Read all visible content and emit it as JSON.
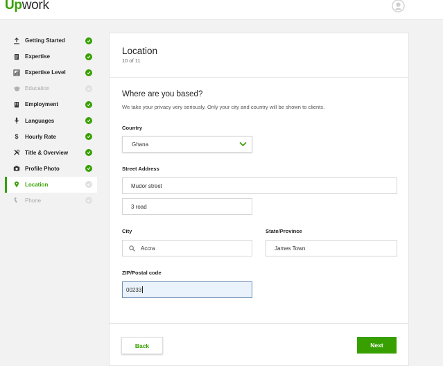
{
  "brand": {
    "logo_up": "Up",
    "logo_rest": "work",
    "accent": "#37a000"
  },
  "sidebar": {
    "items": [
      {
        "label": "Getting Started",
        "icon": "upload-icon",
        "status": "complete"
      },
      {
        "label": "Expertise",
        "icon": "document-icon",
        "status": "complete"
      },
      {
        "label": "Expertise Level",
        "icon": "bar-chart-icon",
        "status": "complete"
      },
      {
        "label": "Education",
        "icon": "graduation-cap-icon",
        "status": "disabled"
      },
      {
        "label": "Employment",
        "icon": "building-icon",
        "status": "complete"
      },
      {
        "label": "Languages",
        "icon": "microphone-icon",
        "status": "complete"
      },
      {
        "label": "Hourly Rate",
        "icon": "dollar-icon",
        "status": "complete"
      },
      {
        "label": "Title & Overview",
        "icon": "tools-icon",
        "status": "complete"
      },
      {
        "label": "Profile Photo",
        "icon": "camera-icon",
        "status": "complete"
      },
      {
        "label": "Location",
        "icon": "map-pin-icon",
        "status": "active"
      },
      {
        "label": "Phone",
        "icon": "phone-icon",
        "status": "disabled"
      }
    ]
  },
  "card": {
    "title": "Location",
    "step": "10 of 11",
    "question": "Where are you based?",
    "privacy_note": "We take your privacy very seriously. Only your city and country will be shown to clients."
  },
  "form": {
    "country_label": "Country",
    "country_value": "Ghana",
    "street_label": "Street Address",
    "street_value": "Mudor street",
    "street2_value": "3 road",
    "city_label": "City",
    "city_value": "Accra",
    "state_label": "State/Province",
    "state_value": "James Town",
    "zip_label": "ZIP/Postal code",
    "zip_value": "00233"
  },
  "actions": {
    "back_label": "Back",
    "next_label": "Next"
  }
}
